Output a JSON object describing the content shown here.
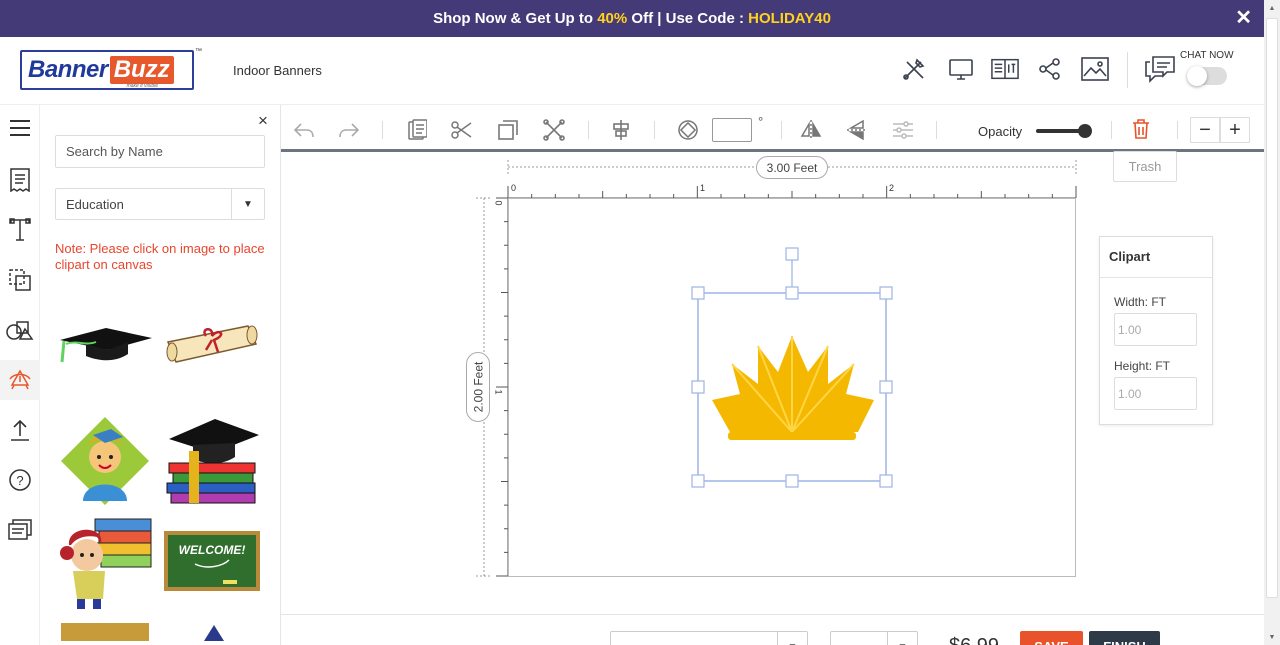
{
  "promo": {
    "text_before": "Shop Now & Get Up to ",
    "percent": "40%",
    "text_middle": " Off | Use Code : ",
    "code": "HOLIDAY40",
    "close_icon": "close-icon"
  },
  "header": {
    "logo_part1": "Banner",
    "logo_part2": "Buzz",
    "logo_tm": "™",
    "logo_tagline": "make it visible",
    "breadcrumb": "Indoor Banners",
    "chat_label": "CHAT NOW",
    "icons": [
      "tools-icon",
      "monitor-icon",
      "book-icon",
      "share-icon",
      "image-icon",
      "chat-icon"
    ]
  },
  "sidebar": {
    "close": "×",
    "search_placeholder": "Search by Name",
    "category": "Education",
    "note": "Note: Please click on image to place clipart on canvas",
    "icons": [
      "menu-icon",
      "template-icon",
      "text-icon",
      "layers-icon",
      "shapes-icon",
      "clipart-icon",
      "upload-icon",
      "help-icon",
      "notes-icon"
    ]
  },
  "toolbar": {
    "degree_symbol": "°",
    "opacity_label": "Opacity",
    "opacity_value": 1,
    "trash_tooltip": "Trash",
    "zoom_out": "−",
    "zoom_in": "+"
  },
  "canvas": {
    "width_label": "3.00 Feet",
    "height_label": "2.00 Feet",
    "ruler_top_labels": [
      "0",
      "1",
      "2"
    ],
    "ruler_left_labels": [
      "0",
      "1"
    ]
  },
  "properties": {
    "title": "Clipart",
    "width_label": "Width: FT",
    "width_value": "1.00",
    "height_label": "Height: FT",
    "height_value": "1.00"
  },
  "footer": {
    "price": "$6.99",
    "save_label": "SAVE",
    "finish_label": "FINISH"
  },
  "colors": {
    "promo_bg": "#453a78",
    "promo_highlight": "#ffd21f",
    "brand_blue": "#1f3a9a",
    "brand_orange": "#e8582d",
    "note_red": "#e8452d",
    "save_bg": "#e8532b",
    "finish_bg": "#2f3a48",
    "clipart_gold": "#f5b800"
  }
}
